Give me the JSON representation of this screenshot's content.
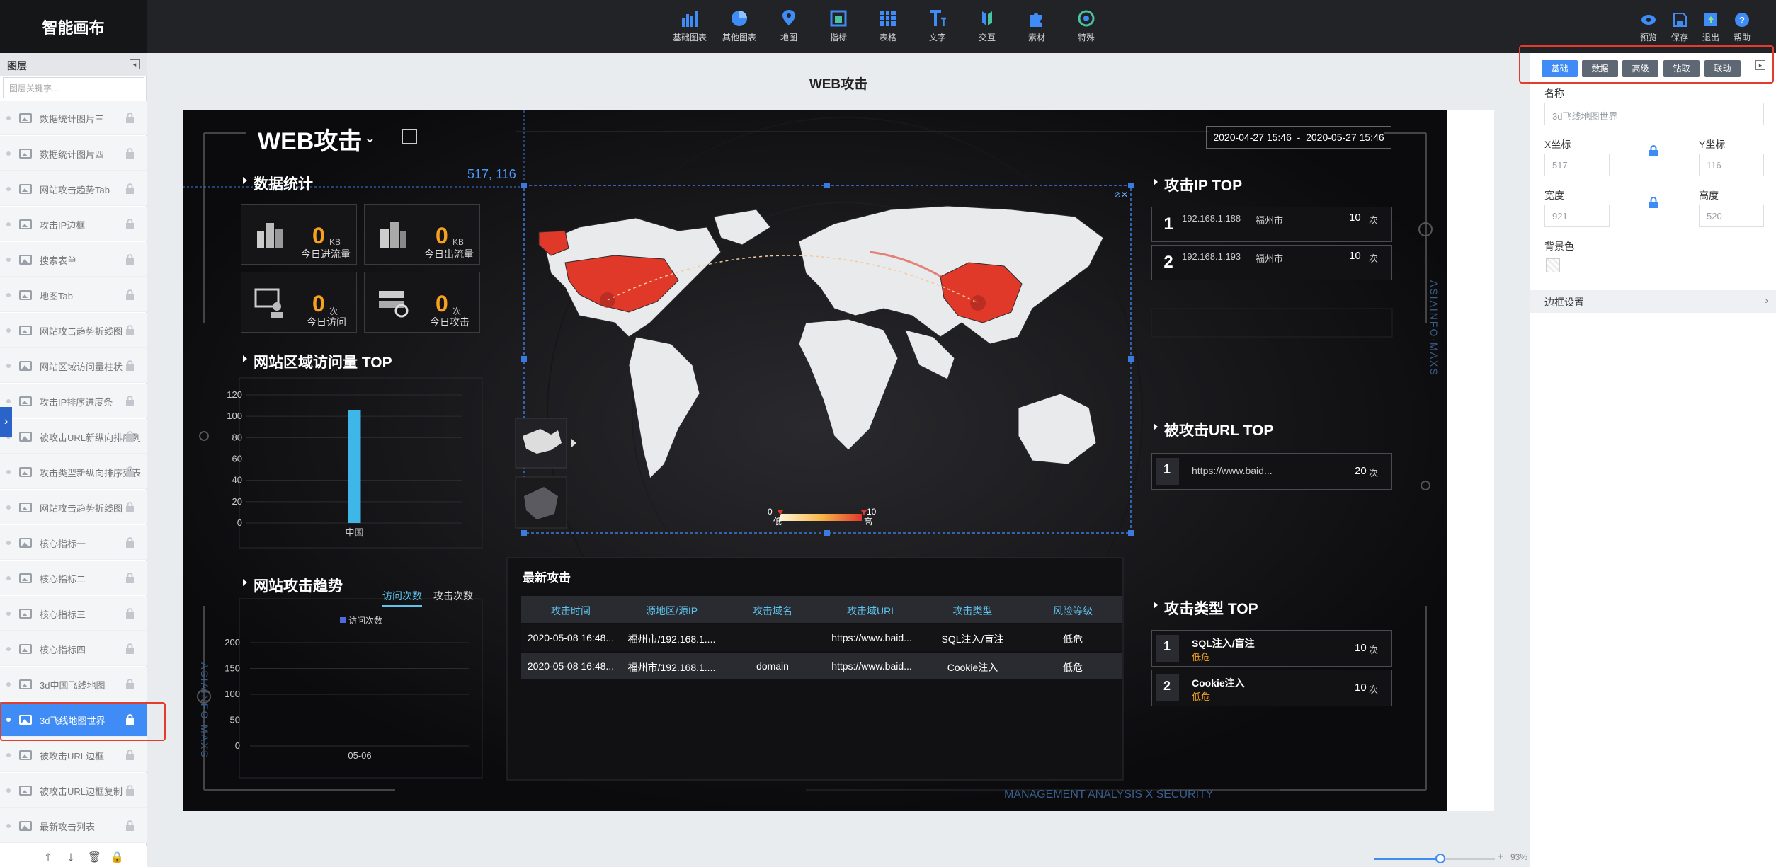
{
  "app": {
    "title": "智能画布"
  },
  "toolbar": {
    "items": [
      {
        "label": "基础图表",
        "icon": "bar-chart-icon"
      },
      {
        "label": "其他图表",
        "icon": "pie-chart-icon"
      },
      {
        "label": "地图",
        "icon": "map-pin-icon"
      },
      {
        "label": "指标",
        "icon": "indicator-icon"
      },
      {
        "label": "表格",
        "icon": "table-icon"
      },
      {
        "label": "文字",
        "icon": "text-icon"
      },
      {
        "label": "交互",
        "icon": "interact-icon"
      },
      {
        "label": "素材",
        "icon": "puzzle-icon"
      },
      {
        "label": "特殊",
        "icon": "special-icon"
      }
    ],
    "right": [
      {
        "label": "预览",
        "icon": "eye-icon"
      },
      {
        "label": "保存",
        "icon": "save-icon"
      },
      {
        "label": "退出",
        "icon": "exit-icon"
      },
      {
        "label": "帮助",
        "icon": "help-icon"
      }
    ],
    "accent": "#3f8cf6"
  },
  "layers": {
    "title": "图层",
    "search_placeholder": "图层关键字...",
    "items": [
      "数据统计图片三",
      "数据统计图片四",
      "网站攻击趋势Tab",
      "攻击IP边框",
      "搜索表单",
      "地图Tab",
      "网站攻击趋势折线图",
      "网站区域访问量柱状",
      "攻击IP排序进度条",
      "被攻击URL新纵向排序列",
      "攻击类型新纵向排序列表",
      "网站攻击趋势折线图",
      "核心指标一",
      "核心指标二",
      "核心指标三",
      "核心指标四",
      "3d中国飞线地图",
      "3d飞线地图世界",
      "被攻击URL边框",
      "被攻击URL边框复制",
      "最新攻击列表"
    ],
    "selected_index": 17
  },
  "canvas": {
    "page_title": "WEB攻击",
    "zoom": "93%"
  },
  "dashboard": {
    "title": "WEB攻击",
    "date_range": "2020-04-27 15:46  -  2020-05-27 15:46",
    "coord_readout": "517, 116",
    "stats_title": "数据统计",
    "stats": [
      {
        "value": "0",
        "unit": "KB",
        "label": "今日进流量"
      },
      {
        "value": "0",
        "unit": "KB",
        "label": "今日出流量"
      },
      {
        "value": "0",
        "unit": "次",
        "label": "今日访问"
      },
      {
        "value": "0",
        "unit": "次",
        "label": "今日攻击"
      }
    ],
    "region_title": "网站区域访问量 TOP",
    "trend_title": "网站攻击趋势",
    "trend_tabs": [
      "访问次数",
      "攻击次数"
    ],
    "map_legend": {
      "min": "0",
      "max": "10",
      "low": "低",
      "high": "高"
    },
    "ip_title": "攻击IP TOP",
    "ip_rows": [
      {
        "rank": "1",
        "ip": "192.168.1.188",
        "city": "福州市",
        "count": "10",
        "unit": "次",
        "progress": 1.0
      },
      {
        "rank": "2",
        "ip": "192.168.1.193",
        "city": "福州市",
        "count": "10",
        "unit": "次",
        "progress": 1.0
      }
    ],
    "url_title": "被攻击URL TOP",
    "url_rows": [
      {
        "rank": "1",
        "url": "https://www.baid...",
        "count": "20",
        "unit": "次"
      }
    ],
    "latest_title": "最新攻击",
    "latest_headers": [
      "攻击时间",
      "源地区/源IP",
      "攻击域名",
      "攻击域URL",
      "攻击类型",
      "风险等级"
    ],
    "latest_rows": [
      [
        "2020-05-08 16:48...",
        "福州市/192.168.1....",
        "",
        "https://www.baid...",
        "SQL注入/盲注",
        "低危"
      ],
      [
        "2020-05-08 16:48...",
        "福州市/192.168.1....",
        "domain",
        "https://www.baid...",
        "Cookie注入",
        "低危"
      ]
    ],
    "type_title": "攻击类型 TOP",
    "type_rows": [
      {
        "rank": "1",
        "name": "SQL注入/盲注",
        "level": "低危",
        "count": "10",
        "unit": "次"
      },
      {
        "rank": "2",
        "name": "Cookie注入",
        "level": "低危",
        "count": "10",
        "unit": "次"
      }
    ],
    "side_brand": "ASIAINFO·MAXS",
    "footer_brand": "MANAGEMENT ANALYSIS X SECURITY",
    "colors": {
      "bar": "#3fb6e8",
      "orange": "#f7a11f",
      "map_hot": "#e0392a",
      "progress_from": "#4a8be0",
      "progress_to": "#62e5d8"
    }
  },
  "chart_data": [
    {
      "type": "bar",
      "categories": [
        "中国"
      ],
      "values": [
        106
      ],
      "ylim": [
        0,
        120
      ],
      "yticks": [
        0,
        20,
        40,
        60,
        80,
        100,
        120
      ]
    },
    {
      "type": "line",
      "x": [
        "05-06"
      ],
      "series": [
        {
          "name": "访问次数",
          "values": []
        }
      ],
      "ylim": [
        0,
        200
      ],
      "yticks": [
        0,
        50,
        100,
        150,
        200
      ]
    }
  ],
  "properties": {
    "tabs": [
      "基础",
      "数据",
      "高级",
      "钻取",
      "联动"
    ],
    "active_tab": 0,
    "name_label": "名称",
    "name_value": "3d飞线地图世界",
    "x_label": "X坐标",
    "x_value": "517",
    "y_label": "Y坐标",
    "y_value": "116",
    "w_label": "宽度",
    "w_value": "921",
    "h_label": "高度",
    "h_value": "520",
    "bg_label": "背景色",
    "section": "边框设置"
  }
}
